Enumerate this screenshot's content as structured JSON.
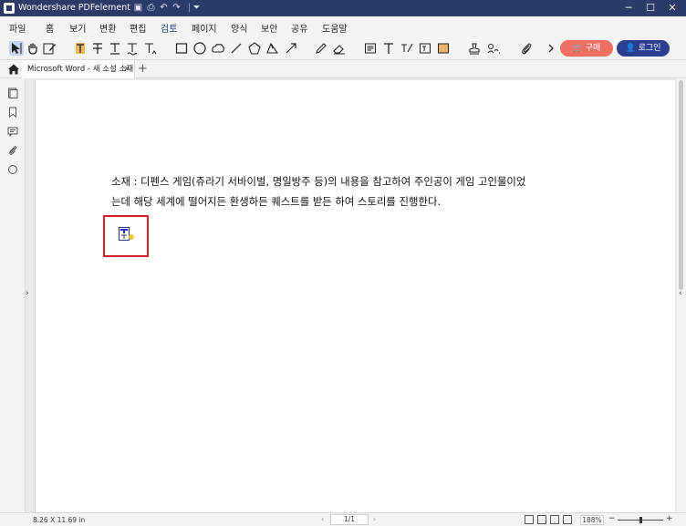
{
  "app": {
    "title": "Wondershare PDFelement"
  },
  "menu": {
    "items": [
      "파일",
      "홈",
      "보기",
      "변환",
      "편집",
      "검토",
      "페이지",
      "양식",
      "보안",
      "공유",
      "도움말"
    ],
    "active": "검토"
  },
  "header_buttons": {
    "buy": "구매",
    "login": "로그인"
  },
  "tab": {
    "label": "Microsoft Word - 새 소설 소재",
    "close": "×",
    "add": "+"
  },
  "document": {
    "text_line1": "소재 : 디펜스 게임(쥬라기 서바이벌, 명일방주 등)의 내용을 참고하여 주인공이 게임 고인물이었",
    "text_line2": "는데 해당 세계에 떨어지든 환생하든 퀘스트를 받든 하여 스토리를 진행한다."
  },
  "status": {
    "page_size": "8.26 X 11.69 in",
    "page_indicator": "1/1",
    "zoom": "188%"
  },
  "colors": {
    "titlebar": "#2b3a67",
    "buy": "#ef6f62",
    "login": "#2a3f8f",
    "annotation_frame": "#d32028",
    "active_menu_underline": "#3557c2"
  },
  "icons": {
    "toolbar": [
      "select-arrow-icon",
      "hand-icon",
      "edit-icon",
      "highlight-text-icon",
      "strikethrough-text-icon",
      "underline-text-icon",
      "squiggly-text-icon",
      "insert-text-icon",
      "rectangle-icon",
      "circle-icon",
      "cloud-icon",
      "line-icon",
      "pentagon-icon",
      "polygon-icon",
      "arrow-icon",
      "pencil-icon",
      "eraser-icon",
      "note-icon",
      "text-icon",
      "text-callout-icon",
      "textbox-icon",
      "area-highlight-icon",
      "stamp-icon",
      "signature-icon",
      "attachment-icon"
    ],
    "sidebar": [
      "bookmark-panel-icon",
      "thumbnail-icon",
      "comment-icon",
      "attachment-panel-icon",
      "search-icon"
    ]
  }
}
